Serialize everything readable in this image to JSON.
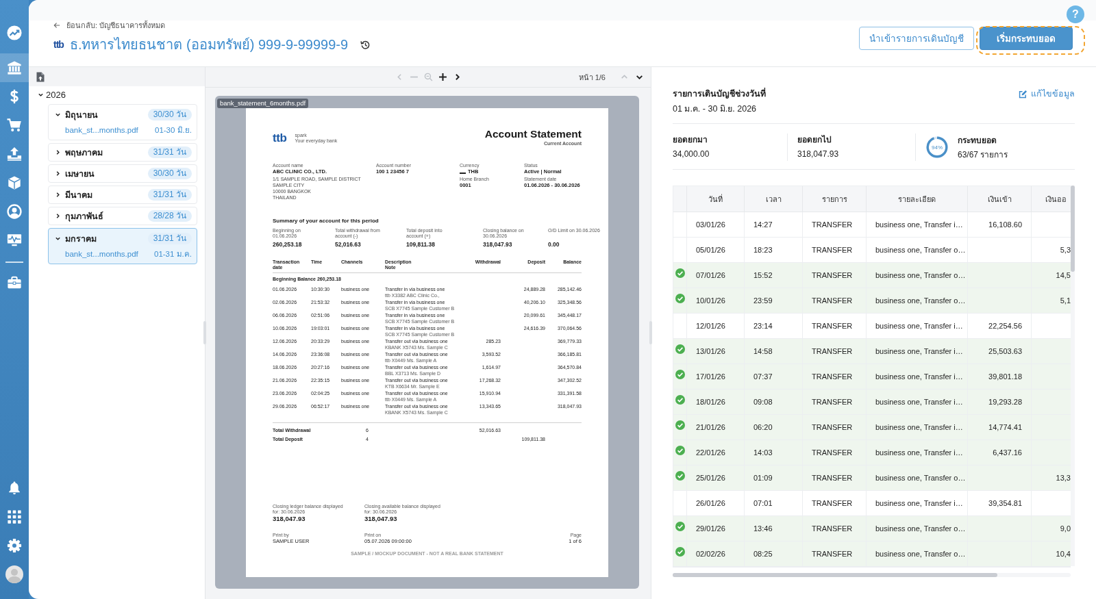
{
  "nav": {
    "items": [
      {
        "selected": false
      },
      {
        "selected": true
      },
      {
        "selected": false
      },
      {
        "selected": false
      },
      {
        "selected": false
      },
      {
        "selected": false
      },
      {
        "selected": false
      },
      {
        "selected": false
      },
      {
        "selected": false
      }
    ]
  },
  "help_button": "?",
  "header": {
    "back_link": "ย้อนกลับ: บัญชีธนาคารทั้งหมด",
    "logo": "ttb",
    "title": "ธ.ทหารไทยธนชาต (ออมทรัพย์) 999-9-99999-9",
    "buttons": [
      {
        "label": "นำเข้ารายการเดินบัญชี",
        "kind": "outline",
        "highlighted": false
      },
      {
        "label": "เริ่มกระทบยอด",
        "kind": "primary",
        "highlighted": true
      }
    ]
  },
  "files": {
    "tree": [
      {
        "label": "2026",
        "expanded": true,
        "children": [
          {
            "label": "มิถุนายน",
            "badge": "30/30 วัน",
            "expanded": true,
            "selected": false,
            "children": [
              {
                "name": "bank_st...months.pdf",
                "range": "01-30 มิ.ย."
              }
            ]
          },
          {
            "label": "พฤษภาคม",
            "badge": "31/31 วัน",
            "expanded": false,
            "selected": false
          },
          {
            "label": "เมษายน",
            "badge": "30/30 วัน",
            "expanded": false,
            "selected": false
          },
          {
            "label": "มีนาคม",
            "badge": "31/31 วัน",
            "expanded": false,
            "selected": false
          },
          {
            "label": "กุมภาพันธ์",
            "badge": "28/28 วัน",
            "expanded": false,
            "selected": false
          },
          {
            "label": "มกราคม",
            "badge": "31/31 วัน",
            "expanded": true,
            "selected": true,
            "children": [
              {
                "name": "bank_st...months.pdf",
                "range": "01-31 ม.ค."
              }
            ]
          }
        ]
      }
    ]
  },
  "viewer": {
    "toolbar": [
      {
        "kind": "previous",
        "disabled": true
      },
      {
        "kind": "zoom_out",
        "disabled": true
      },
      {
        "kind": "zoom_reset",
        "disabled": true
      },
      {
        "kind": "zoom_in",
        "disabled": false
      },
      {
        "kind": "next",
        "disabled": false
      }
    ],
    "page_indicator": "หน้า 1/6",
    "page_nav": [
      {
        "kind": "up",
        "disabled": true
      },
      {
        "kind": "down",
        "disabled": false
      }
    ],
    "file_tag": "bank_statement_6months.pdf",
    "page": {
      "logo": "ttb",
      "tagline": [
        "spark",
        "Your everyday bank"
      ],
      "title": "Account Statement",
      "subtitle": "Current Account",
      "account_name": {
        "label": "Account name",
        "value": "ABC CLINIC CO., LTD.",
        "address": [
          "1/1 SAMPLE ROAD, SAMPLE DISTRICT",
          "SAMPLE CITY",
          "10000 BANGKOK",
          "THAILAND"
        ]
      },
      "account_number": {
        "label": "Account number",
        "value": "100 1 23456 7"
      },
      "currency": {
        "label": "Currency",
        "value": "THB"
      },
      "home_branch": {
        "label": "Home Branch",
        "value": "0001"
      },
      "status": {
        "label": "Status",
        "value": "Active | Normal"
      },
      "statement_date": {
        "label": "Statement date",
        "value": "01.06.2026 - 30.06.2026"
      },
      "summary_title": "Summary of your account for this period",
      "summary": [
        {
          "label": "Beginning on\n01.06.2026",
          "value": "260,253.18"
        },
        {
          "label": "Total withdrawal from\naccount (-)",
          "value": "52,016.63"
        },
        {
          "label": "Total deposit into\naccount (+)",
          "value": "109,811.38"
        },
        {
          "label": "Closing balance on\n30.06.2026",
          "value": "318,047.93"
        },
        {
          "label": "O/D Limit on 30.06.2026",
          "value": "0.00"
        }
      ],
      "columns": [
        "Transaction\ndate",
        "Time",
        "Channels",
        "Description\nNote",
        "Withdrawal",
        "Deposit",
        "Balance"
      ],
      "beginning": {
        "label": "Beginning Balance",
        "value": "260,253.18"
      },
      "transactions": [
        {
          "date": "01.06.2026",
          "time": "10:30:30",
          "channel": "business one",
          "description": "Transfer in via business one",
          "note": "ttb X3382 ABC Clinic Co.,",
          "deposit": "24,889.28",
          "balance": "285,142.46"
        },
        {
          "date": "02.06.2026",
          "time": "21:53:32",
          "channel": "business one",
          "description": "Transfer in via business one",
          "note": "SCB X7745 Sample Customer B",
          "deposit": "40,206.10",
          "balance": "325,348.56"
        },
        {
          "date": "06.06.2026",
          "time": "02:51:06",
          "channel": "business one",
          "description": "Transfer in via business one",
          "note": "SCB X7745 Sample Customer B",
          "deposit": "20,099.61",
          "balance": "345,448.17"
        },
        {
          "date": "10.06.2026",
          "time": "19:03:01",
          "channel": "business one",
          "description": "Transfer in via business one",
          "note": "SCB X7745 Sample Customer B",
          "deposit": "24,616.39",
          "balance": "370,064.56"
        },
        {
          "date": "12.06.2026",
          "time": "20:33:29",
          "channel": "business one",
          "description": "Transfer out via business one",
          "note": "KBANK X5743 Ms. Sample C",
          "withdrawal": "285.23",
          "balance": "369,779.33"
        },
        {
          "date": "14.06.2026",
          "time": "23:36:08",
          "channel": "business one",
          "description": "Transfer out via business one",
          "note": "ttb X0449 Ms. Sample A",
          "withdrawal": "3,593.52",
          "balance": "366,185.81"
        },
        {
          "date": "18.06.2026",
          "time": "20:27:16",
          "channel": "business one",
          "description": "Transfer out via business one",
          "note": "BBL X3713 Ms. Sample D",
          "withdrawal": "1,614.97",
          "balance": "364,570.84"
        },
        {
          "date": "21.06.2026",
          "time": "22:35:15",
          "channel": "business one",
          "description": "Transfer out via business one",
          "note": "KTB X6634 Mr. Sample E",
          "withdrawal": "17,268.32",
          "balance": "347,302.52"
        },
        {
          "date": "23.06.2026",
          "time": "02:04:25",
          "channel": "business one",
          "description": "Transfer out via business one",
          "note": "ttb X0449 Ms. Sample A",
          "withdrawal": "15,910.94",
          "balance": "331,391.58"
        },
        {
          "date": "29.06.2026",
          "time": "06:52:17",
          "channel": "business one",
          "description": "Transfer out via business one",
          "note": "KBANK X5743 Ms. Sample C",
          "withdrawal": "13,343.65",
          "balance": "318,047.93"
        }
      ],
      "totals": [
        {
          "label": "Total Withdrawal",
          "count": "6",
          "withdrawal": "52,016.63"
        },
        {
          "label": "Total Deposit",
          "count": "4",
          "deposit": "109,811.38"
        }
      ],
      "closing": [
        {
          "label": "Closing ledger balance displayed\nfor: 30.06.2026",
          "value": "318,047.93"
        },
        {
          "label": "Closing available balance displayed\nfor: 30.06.2026",
          "value": "318,047.93"
        }
      ],
      "print_by": {
        "label": "Print by",
        "value": "SAMPLE USER"
      },
      "print_on": {
        "label": "Print on",
        "value": "05.07.2026 09:00:00"
      },
      "page_number": {
        "label": "Page",
        "value": "1 of 6"
      },
      "footer": "SAMPLE / MOCKUP DOCUMENT - NOT A REAL BANK STATEMENT"
    }
  },
  "summary": {
    "period_label": "รายการเดินบัญชีช่วงวันที่",
    "period": "01 ม.ค. - 30 มิ.ย. 2026",
    "edit_link": "แก้ไขข้อมูล",
    "stats": [
      {
        "label": "ยอดยกมา",
        "value": "34,000.00"
      },
      {
        "label": "ยอดยกไป",
        "value": "318,047.93"
      }
    ],
    "reconcile": {
      "label": "กระทบยอด",
      "value": "63/67 รายการ",
      "percent": "94%",
      "level": 0.94
    }
  },
  "table": {
    "columns": [
      "วันที่",
      "เวลา",
      "รายการ",
      "รายละเอียด",
      "เงินเข้า",
      "เงินออ"
    ],
    "rows": [
      {
        "matched": false,
        "date": "03/01/26",
        "time": "14:27",
        "type": "TRANSFER",
        "detail": "business one, Transfer i…",
        "amount_in": "16,108.60"
      },
      {
        "matched": false,
        "date": "05/01/26",
        "time": "18:23",
        "type": "TRANSFER",
        "detail": "business one, Transfer o…",
        "amount_out": "5,3"
      },
      {
        "matched": true,
        "date": "07/01/26",
        "time": "15:52",
        "type": "TRANSFER",
        "detail": "business one, Transfer o…",
        "amount_out": "14,5"
      },
      {
        "matched": true,
        "date": "10/01/26",
        "time": "23:59",
        "type": "TRANSFER",
        "detail": "business one, Transfer o…",
        "amount_out": "5,1"
      },
      {
        "matched": false,
        "date": "12/01/26",
        "time": "23:14",
        "type": "TRANSFER",
        "detail": "business one, Transfer i…",
        "amount_in": "22,254.56"
      },
      {
        "matched": true,
        "date": "13/01/26",
        "time": "14:58",
        "type": "TRANSFER",
        "detail": "business one, Transfer i…",
        "amount_in": "25,503.63"
      },
      {
        "matched": true,
        "date": "17/01/26",
        "time": "07:37",
        "type": "TRANSFER",
        "detail": "business one, Transfer i…",
        "amount_in": "39,801.18"
      },
      {
        "matched": true,
        "date": "18/01/26",
        "time": "09:08",
        "type": "TRANSFER",
        "detail": "business one, Transfer i…",
        "amount_in": "19,293.28"
      },
      {
        "matched": true,
        "date": "21/01/26",
        "time": "06:20",
        "type": "TRANSFER",
        "detail": "business one, Transfer i…",
        "amount_in": "14,774.41"
      },
      {
        "matched": true,
        "date": "22/01/26",
        "time": "14:03",
        "type": "TRANSFER",
        "detail": "business one, Transfer i…",
        "amount_in": "6,437.16"
      },
      {
        "matched": true,
        "date": "25/01/26",
        "time": "01:09",
        "type": "TRANSFER",
        "detail": "business one, Transfer o…",
        "amount_out": "13,3"
      },
      {
        "matched": false,
        "date": "26/01/26",
        "time": "07:01",
        "type": "TRANSFER",
        "detail": "business one, Transfer i…",
        "amount_in": "39,354.81"
      },
      {
        "matched": true,
        "date": "29/01/26",
        "time": "13:46",
        "type": "TRANSFER",
        "detail": "business one, Transfer o…",
        "amount_out": "9,0"
      },
      {
        "matched": true,
        "date": "02/02/26",
        "time": "08:25",
        "type": "TRANSFER",
        "detail": "business one, Transfer o…",
        "amount_out": "10,4"
      }
    ]
  }
}
